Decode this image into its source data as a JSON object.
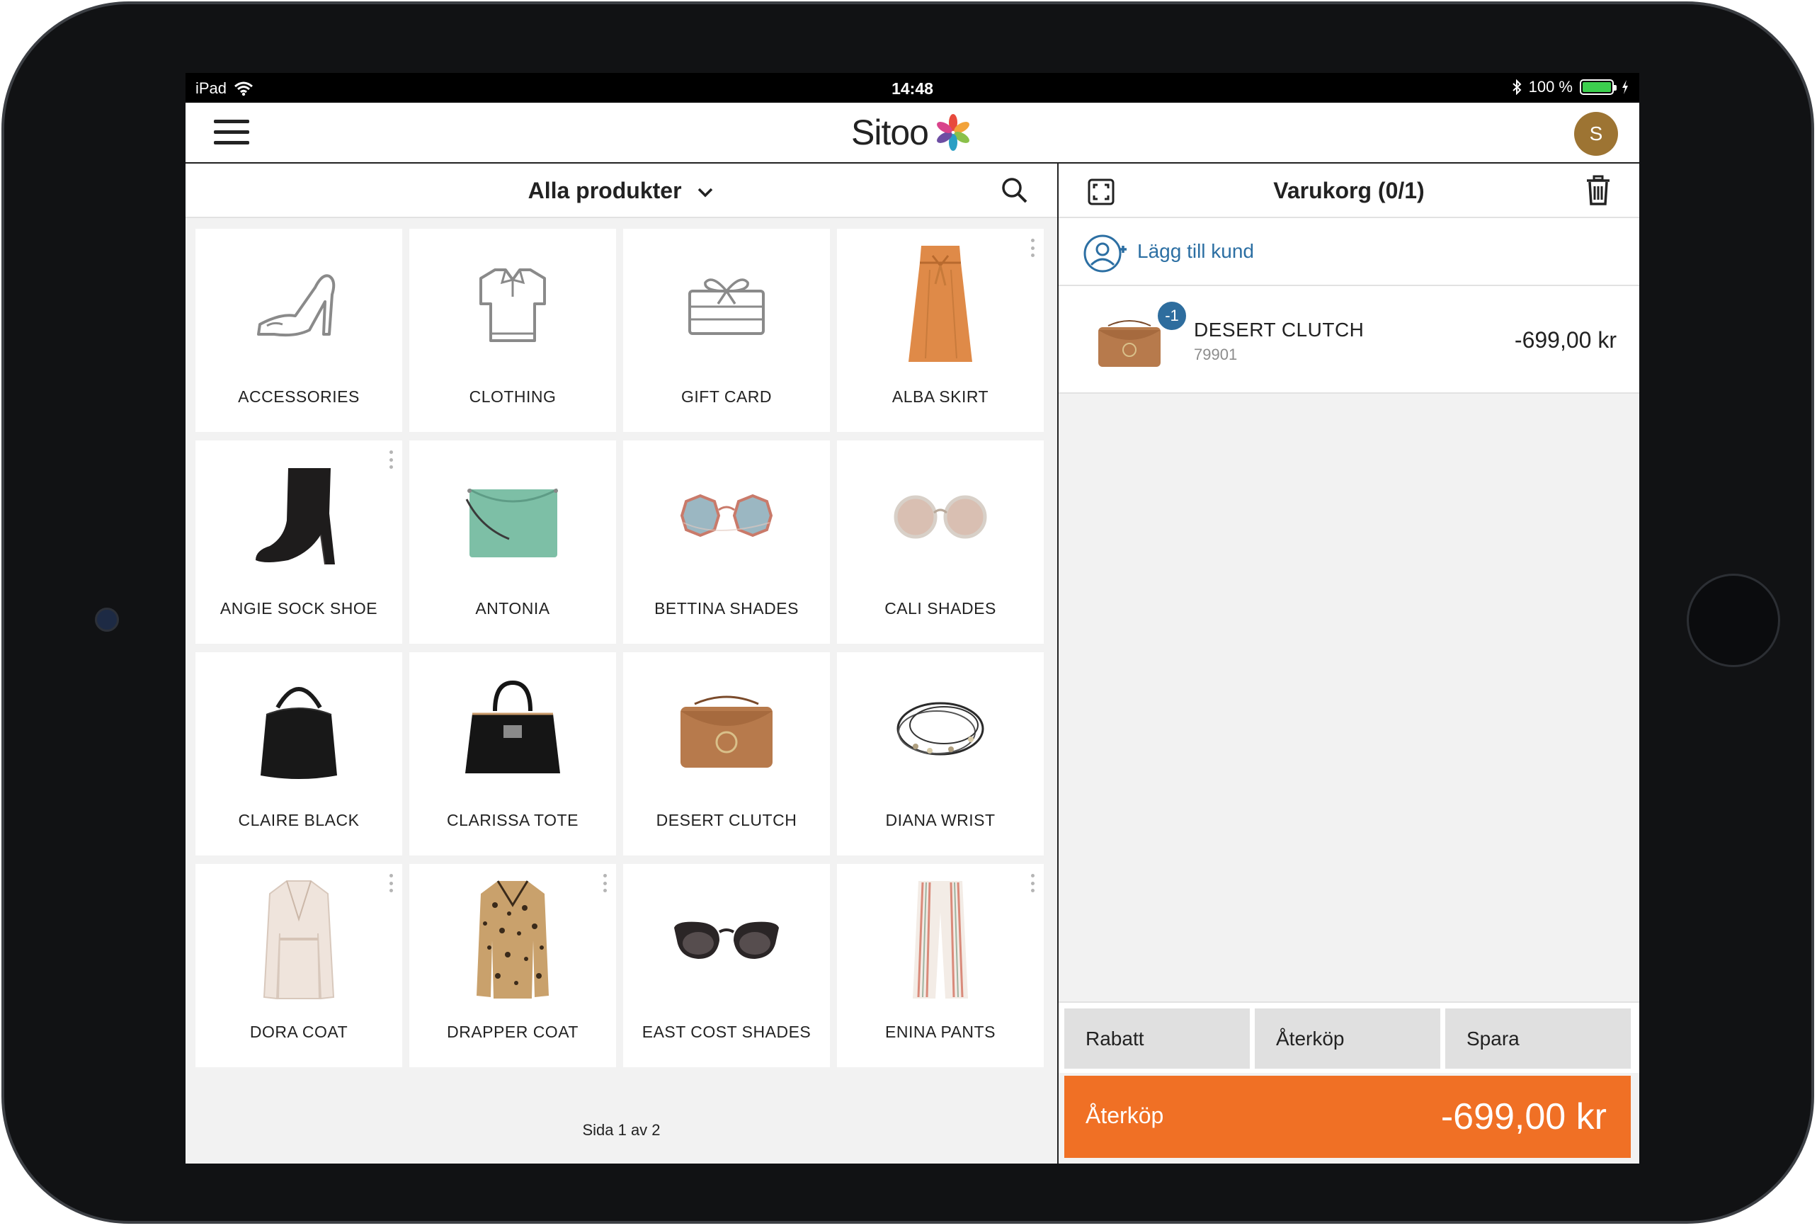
{
  "status_bar": {
    "device": "iPad",
    "time": "14:48",
    "battery": "100 %"
  },
  "header": {
    "logo": "Sitoo",
    "avatar_initial": "S"
  },
  "catalog": {
    "title": "Alla produkter",
    "products": [
      {
        "label": "ACCESSORIES",
        "icon": "shoe-outline-icon"
      },
      {
        "label": "CLOTHING",
        "icon": "shirt-outline-icon"
      },
      {
        "label": "GIFT CARD",
        "icon": "gift-card-outline-icon"
      },
      {
        "label": "ALBA SKIRT",
        "icon": "skirt-icon"
      },
      {
        "label": "ANGIE SOCK SHOE",
        "icon": "boot-icon"
      },
      {
        "label": "ANTONIA",
        "icon": "green-bag-icon"
      },
      {
        "label": "BETTINA SHADES",
        "icon": "octagon-sunglasses-icon"
      },
      {
        "label": "CALI SHADES",
        "icon": "round-sunglasses-icon"
      },
      {
        "label": "CLAIRE BLACK",
        "icon": "hobo-bag-icon"
      },
      {
        "label": "CLARISSA TOTE",
        "icon": "tote-bag-icon"
      },
      {
        "label": "DESERT CLUTCH",
        "icon": "clutch-bag-icon"
      },
      {
        "label": "DIANA WRIST",
        "icon": "bracelet-icon"
      },
      {
        "label": "DORA COAT",
        "icon": "white-coat-icon"
      },
      {
        "label": "DRAPPER COAT",
        "icon": "leopard-coat-icon"
      },
      {
        "label": "EAST COST SHADES",
        "icon": "cat-eye-sunglasses-icon"
      },
      {
        "label": "ENINA PANTS",
        "icon": "striped-pants-icon"
      }
    ],
    "pager": "Sida 1 av 2"
  },
  "cart": {
    "title": "Varukorg (0/1)",
    "add_customer": "Lägg till kund",
    "items": [
      {
        "name": "DESERT CLUTCH",
        "sku": "79901",
        "qty": "-1",
        "price": "-699,00 kr"
      }
    ],
    "actions": {
      "discount": "Rabatt",
      "return": "Återköp",
      "save": "Spara"
    },
    "checkout": {
      "label": "Återköp",
      "amount": "-699,00 kr"
    }
  },
  "colors": {
    "accent": "#f07025",
    "badge": "#2e6d9e",
    "link": "#2c6fa3",
    "avatar": "#9d7433"
  }
}
